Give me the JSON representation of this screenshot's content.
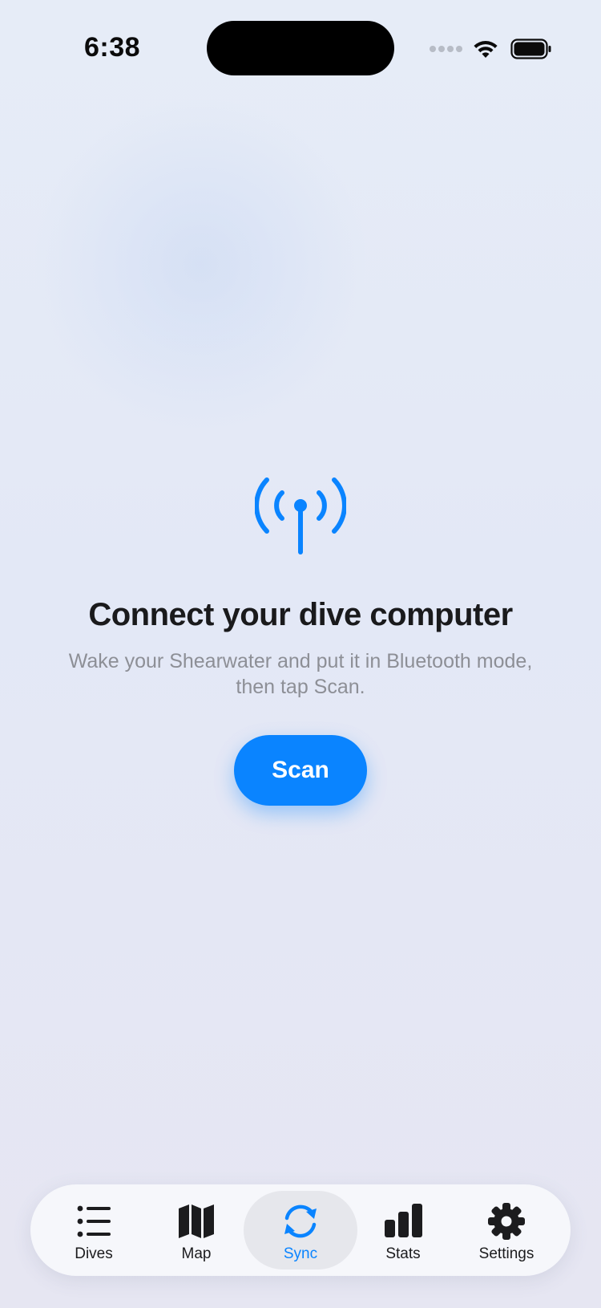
{
  "status_bar": {
    "time": "6:38",
    "icons": [
      "cellular-signal-icon",
      "wifi-icon",
      "battery-icon"
    ]
  },
  "main": {
    "icon": "antenna-broadcast-icon",
    "title": "Connect your dive computer",
    "subtitle": "Wake your Shearwater and put it in Bluetooth mode, then tap Scan.",
    "scan_label": "Scan"
  },
  "tab_bar": {
    "active": "Sync",
    "tabs": [
      {
        "label": "Dives",
        "icon": "list-icon"
      },
      {
        "label": "Map",
        "icon": "map-icon"
      },
      {
        "label": "Sync",
        "icon": "sync-icon"
      },
      {
        "label": "Stats",
        "icon": "bar-chart-icon"
      },
      {
        "label": "Settings",
        "icon": "gear-icon"
      }
    ]
  },
  "colors": {
    "accent": "#0a84ff",
    "title": "#1a1a1c",
    "subtitle": "#8d8f96",
    "background": "#e4e9f6"
  }
}
